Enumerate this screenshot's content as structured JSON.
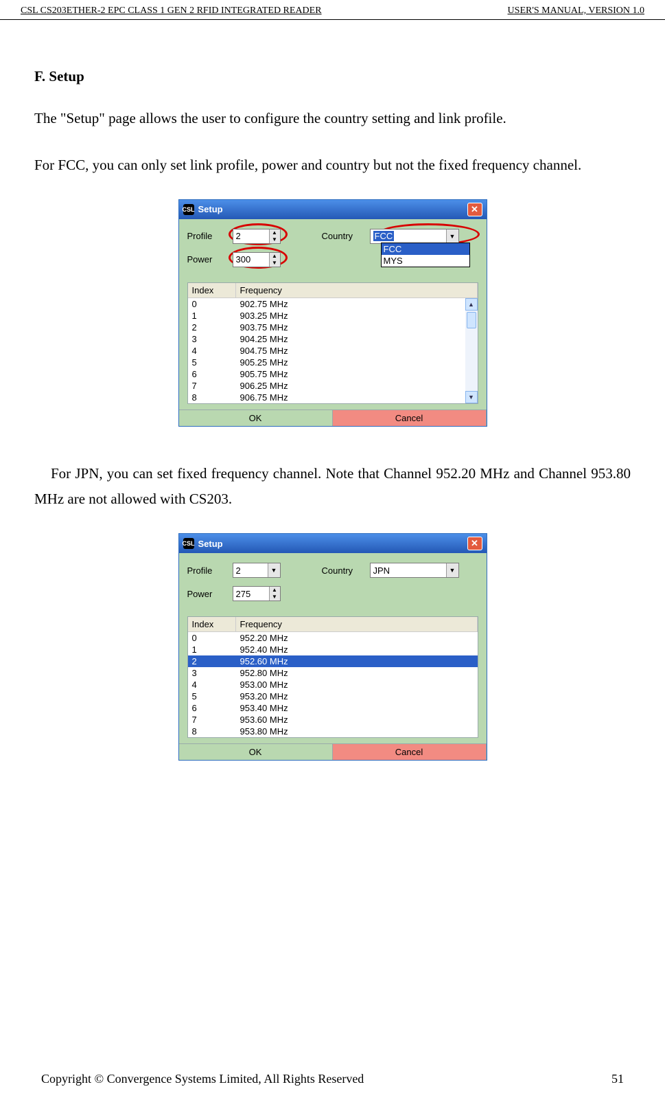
{
  "header": {
    "left": "CSL CS203ETHER-2 EPC CLASS 1 GEN 2 RFID INTEGRATED READER",
    "right": "USER'S  MANUAL,  VERSION  1.0"
  },
  "section": {
    "heading": "F.  Setup"
  },
  "paragraphs": {
    "p1": "The \"Setup\" page allows the user to configure the country setting and link profile.",
    "p2": "For FCC, you can only set link profile, power and country but not the fixed frequency channel.",
    "p3": "For JPN, you can set fixed frequency channel.  Note that Channel 952.20 MHz and Channel 953.80 MHz are not allowed with CS203."
  },
  "window": {
    "title": "Setup",
    "labels": {
      "profile": "Profile",
      "power": "Power",
      "country": "Country",
      "index": "Index",
      "frequency": "Frequency",
      "ok": "OK",
      "cancel": "Cancel"
    }
  },
  "shot1": {
    "profile": "2",
    "power": "300",
    "country_selected": "FCC",
    "country_options": [
      "FCC",
      "MYS"
    ],
    "rows": [
      {
        "idx": "0",
        "freq": "902.75 MHz"
      },
      {
        "idx": "1",
        "freq": "903.25 MHz"
      },
      {
        "idx": "2",
        "freq": "903.75 MHz"
      },
      {
        "idx": "3",
        "freq": "904.25 MHz"
      },
      {
        "idx": "4",
        "freq": "904.75 MHz"
      },
      {
        "idx": "5",
        "freq": "905.25 MHz"
      },
      {
        "idx": "6",
        "freq": "905.75 MHz"
      },
      {
        "idx": "7",
        "freq": "906.25 MHz"
      },
      {
        "idx": "8",
        "freq": "906.75 MHz"
      }
    ]
  },
  "shot2": {
    "profile": "2",
    "power": "275",
    "country": "JPN",
    "selected_row": 2,
    "rows": [
      {
        "idx": "0",
        "freq": "952.20 MHz"
      },
      {
        "idx": "1",
        "freq": "952.40 MHz"
      },
      {
        "idx": "2",
        "freq": "952.60 MHz"
      },
      {
        "idx": "3",
        "freq": "952.80 MHz"
      },
      {
        "idx": "4",
        "freq": "953.00 MHz"
      },
      {
        "idx": "5",
        "freq": "953.20 MHz"
      },
      {
        "idx": "6",
        "freq": "953.40 MHz"
      },
      {
        "idx": "7",
        "freq": "953.60 MHz"
      },
      {
        "idx": "8",
        "freq": "953.80 MHz"
      }
    ]
  },
  "footer": {
    "copyright": "Copyright © Convergence Systems Limited, All Rights Reserved",
    "page": "51"
  }
}
